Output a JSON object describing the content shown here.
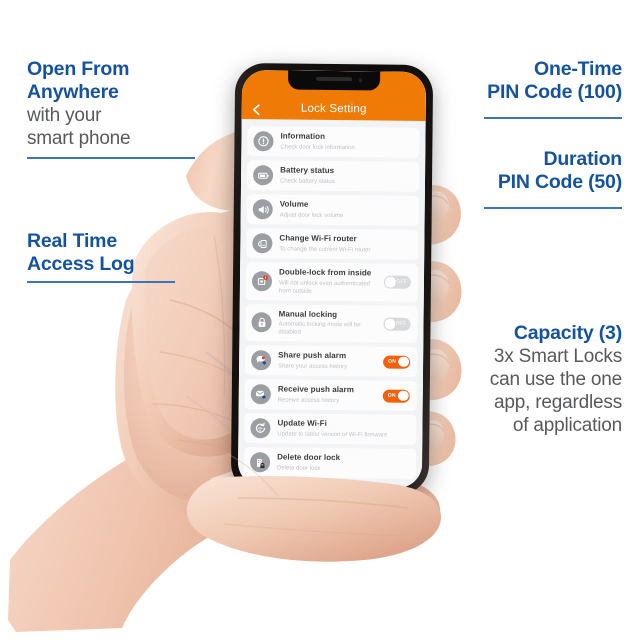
{
  "colors": {
    "accent_blue": "#15539E",
    "divider_blue": "#3E74B7",
    "body_gray": "#58595B",
    "app_orange": "#F07A06",
    "toggle_on": "#F4610C",
    "toggle_off": "#D8DADE",
    "screen_bg": "#F2F3F5"
  },
  "callouts": {
    "open_from_anywhere": {
      "heading_line1": "Open From",
      "heading_line2": "Anywhere",
      "sub_line1": "with your",
      "sub_line2": "smart phone"
    },
    "real_time": {
      "heading_line1": "Real Time",
      "heading_line2": "Access Log"
    },
    "one_time_pin": {
      "heading_line1": "One-Time",
      "heading_line2": "PIN Code (100)"
    },
    "duration_pin": {
      "heading_line1": "Duration",
      "heading_line2": "PIN Code (50)"
    },
    "capacity": {
      "heading_line1": "Capacity (3)",
      "sub_line1": "3x Smart Locks",
      "sub_line2": "can use the one",
      "sub_line3": "app, regardless",
      "sub_line4": "of application"
    }
  },
  "phone": {
    "appbar": {
      "title": "Lock Setting",
      "back_icon": "chevron-left-icon"
    },
    "rows": [
      {
        "icon": "information-icon",
        "title": "Information",
        "subtitle": "Check door lock information",
        "toggle": null
      },
      {
        "icon": "battery-icon",
        "title": "Battery status",
        "subtitle": "Check battery status",
        "toggle": null
      },
      {
        "icon": "volume-icon",
        "title": "Volume",
        "subtitle": "Adjust door lock volume",
        "toggle": null
      },
      {
        "icon": "wifi-router-icon",
        "title": "Change Wi-Fi router",
        "subtitle": "To change the current Wi-Fi router",
        "toggle": null
      },
      {
        "icon": "double-lock-icon",
        "title": "Double-lock from inside",
        "subtitle": "Will not unlock even authenticated from outside",
        "toggle": "OFF"
      },
      {
        "icon": "padlock-icon",
        "title": "Manual locking",
        "subtitle": "Automatic locking mode will be disabled",
        "toggle": "OFF"
      },
      {
        "icon": "share-alarm-icon",
        "title": "Share push alarm",
        "subtitle": "Share your access history",
        "toggle": "ON"
      },
      {
        "icon": "receive-alarm-icon",
        "title": "Receive push alarm",
        "subtitle": "Receive access history",
        "toggle": "ON"
      },
      {
        "icon": "update-wifi-icon",
        "title": "Update Wi-Fi",
        "subtitle": "Update to latest version of Wi-Fi firmware",
        "toggle": null
      },
      {
        "icon": "delete-lock-icon",
        "title": "Delete door lock",
        "subtitle": "Delete door lock",
        "toggle": null
      }
    ]
  }
}
